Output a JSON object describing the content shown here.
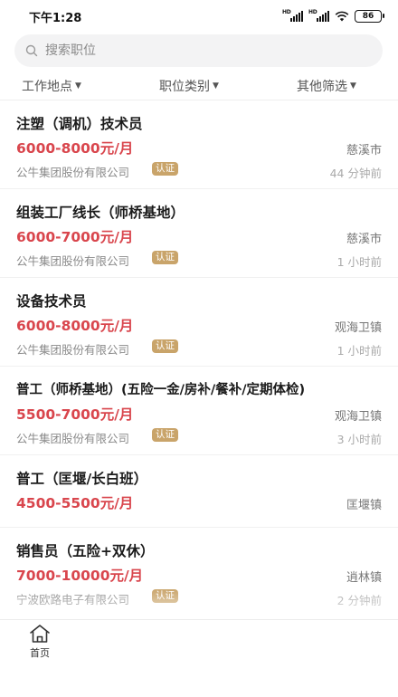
{
  "status_bar": {
    "time": "下午1:28",
    "battery": "86"
  },
  "search": {
    "placeholder": "搜索职位"
  },
  "filters": [
    {
      "label": "工作地点"
    },
    {
      "label": "职位类别"
    },
    {
      "label": "其他筛选"
    }
  ],
  "jobs": [
    {
      "title": "注塑（调机）技术员",
      "salary": "6000-8000元/月",
      "location": "慈溪市",
      "company": "公牛集团股份有限公司",
      "badge": "认证",
      "time": "44 分钟前"
    },
    {
      "title": "组装工厂线长（师桥基地）",
      "salary": "6000-7000元/月",
      "location": "慈溪市",
      "company": "公牛集团股份有限公司",
      "badge": "认证",
      "time": "1 小时前"
    },
    {
      "title": "设备技术员",
      "salary": "6000-8000元/月",
      "location": "观海卫镇",
      "company": "公牛集团股份有限公司",
      "badge": "认证",
      "time": "1 小时前"
    },
    {
      "title": "普工（师桥基地）(五险一金/房补/餐补/定期体检)",
      "salary": "5500-7000元/月",
      "location": "观海卫镇",
      "company": "公牛集团股份有限公司",
      "badge": "认证",
      "time": "3 小时前"
    },
    {
      "title": "普工（匡堰/长白班）",
      "salary": "4500-5500元/月",
      "location": "匡堰镇",
      "company": "",
      "badge": "",
      "time": ""
    },
    {
      "title": "销售员（五险+双休）",
      "salary": "7000-10000元/月",
      "location": "逍林镇",
      "company": "宁波欧路电子有限公司",
      "badge": "认证",
      "time": "2 分钟前"
    }
  ],
  "tabbar": {
    "home_label": "首页"
  },
  "colors": {
    "salary": "#d9464d",
    "badge": "#c9a46a"
  }
}
